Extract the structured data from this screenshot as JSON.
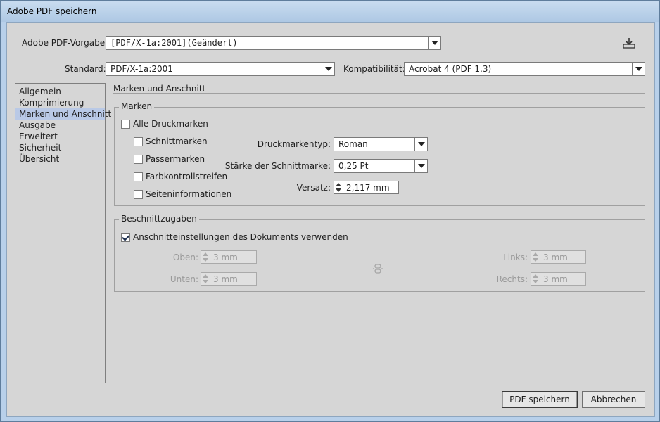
{
  "window": {
    "title": "Adobe PDF speichern"
  },
  "preset": {
    "label": "Adobe PDF-Vorgabe:",
    "value": "[PDF/X-1a:2001](Geändert)",
    "save_icon": "save-preset-icon"
  },
  "standard": {
    "label": "Standard:",
    "value": "PDF/X-1a:2001"
  },
  "compat": {
    "label": "Kompatibilität:",
    "value": "Acrobat 4 (PDF 1.3)"
  },
  "sidebar": {
    "items": [
      {
        "label": "Allgemein"
      },
      {
        "label": "Komprimierung"
      },
      {
        "label": "Marken und Anschnitt"
      },
      {
        "label": "Ausgabe"
      },
      {
        "label": "Erweitert"
      },
      {
        "label": "Sicherheit"
      },
      {
        "label": "Übersicht"
      }
    ],
    "selected": "Marken und Anschnitt"
  },
  "section": {
    "title": "Marken und Anschnitt"
  },
  "marks": {
    "group_title": "Marken",
    "all": {
      "label": "Alle Druckmarken",
      "checked": false
    },
    "crop": {
      "label": "Schnittmarken",
      "checked": false
    },
    "registration": {
      "label": "Passermarken",
      "checked": false
    },
    "colorbars": {
      "label": "Farbkontrollstreifen",
      "checked": false
    },
    "pageinfo": {
      "label": "Seiteninformationen",
      "checked": false
    },
    "type": {
      "label": "Druckmarkentyp:",
      "value": "Roman"
    },
    "weight": {
      "label": "Stärke der Schnittmarke:",
      "value": "0,25 Pt"
    },
    "offset": {
      "label": "Versatz:",
      "value": "2,117 mm"
    }
  },
  "bleed": {
    "group_title": "Beschnittzugaben",
    "use_doc": {
      "label": "Anschnitteinstellungen des Dokuments verwenden",
      "checked": true
    },
    "top": {
      "label": "Oben:",
      "value": "3 mm"
    },
    "bottom": {
      "label": "Unten:",
      "value": "3 mm"
    },
    "left": {
      "label": "Links:",
      "value": "3 mm"
    },
    "right": {
      "label": "Rechts:",
      "value": "3 mm"
    },
    "link_icon": "chain-link-icon"
  },
  "buttons": {
    "save": "PDF speichern",
    "cancel": "Abbrechen"
  }
}
